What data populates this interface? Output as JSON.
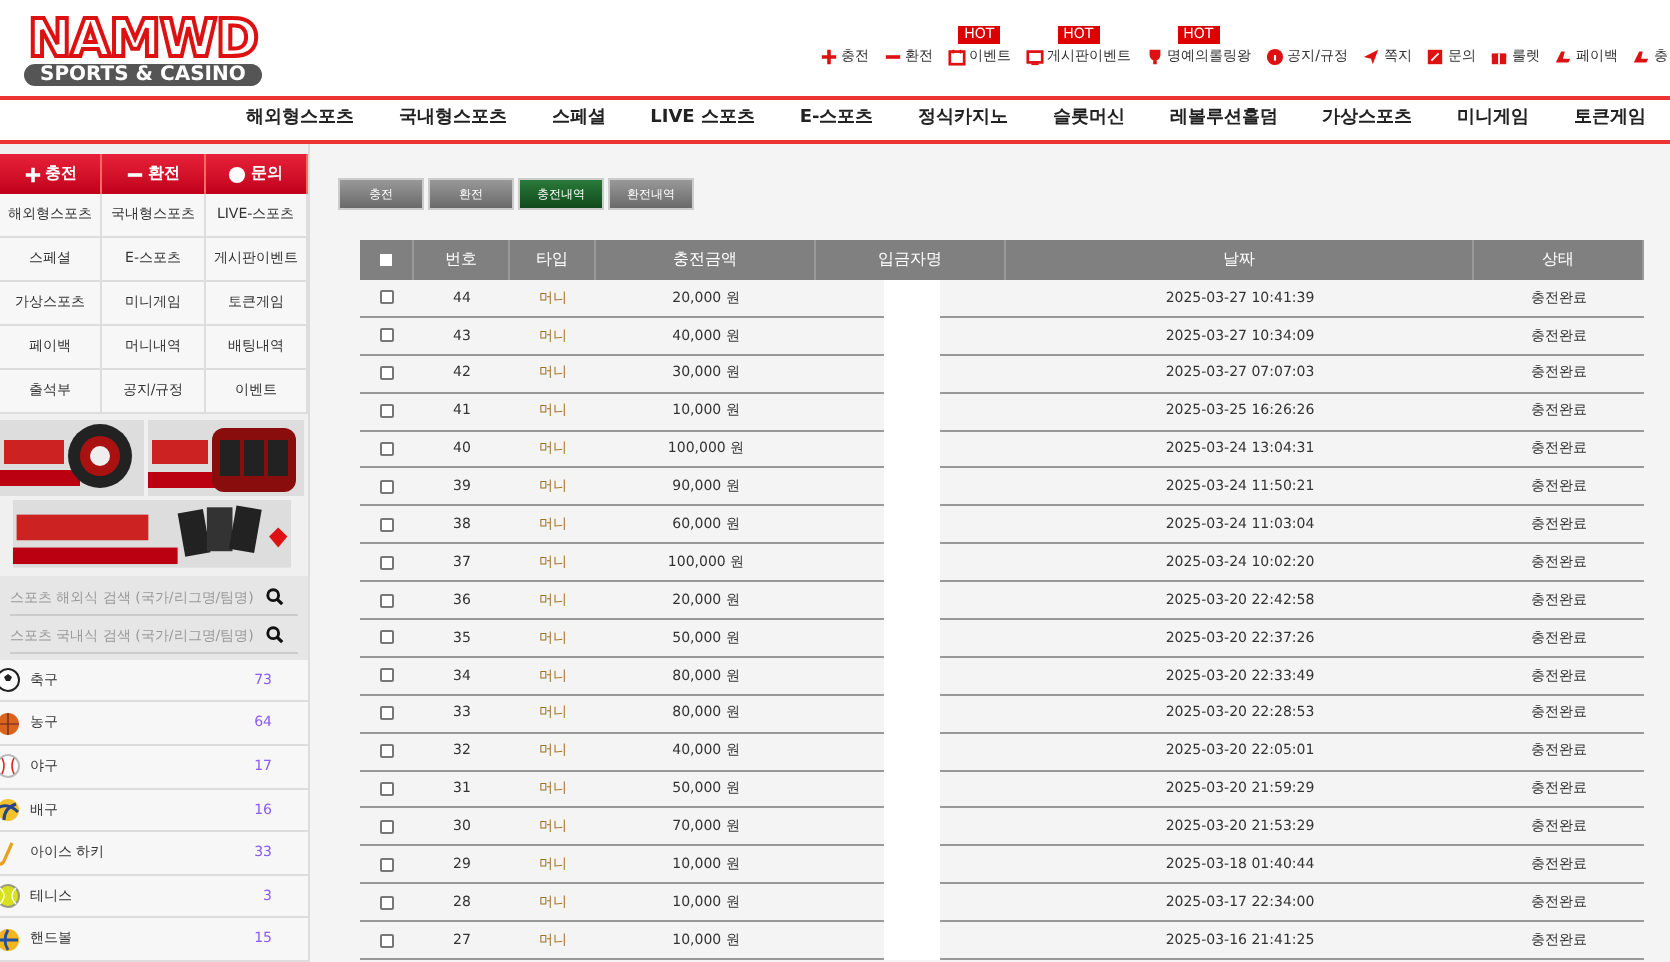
{
  "logo": {
    "name": "NAMWD",
    "tagline": "SPORTS & CASINO"
  },
  "top_links": [
    {
      "label": "충전",
      "hot": false
    },
    {
      "label": "환전",
      "hot": false
    },
    {
      "label": "이벤트",
      "hot": true,
      "badge": "HOT"
    },
    {
      "label": "게시판이벤트",
      "hot": true,
      "badge": "HOT"
    },
    {
      "label": "명예의롤링왕",
      "hot": true,
      "badge": "HOT"
    },
    {
      "label": "공지/규정",
      "hot": false
    },
    {
      "label": "쪽지",
      "hot": false
    },
    {
      "label": "문의",
      "hot": false
    },
    {
      "label": "룰렛",
      "hot": false
    },
    {
      "label": "페이백",
      "hot": false
    },
    {
      "label": "충",
      "hot": false
    }
  ],
  "nav": [
    "해외형스포츠",
    "국내형스포츠",
    "스페셜",
    "LIVE 스포츠",
    "E-스포츠",
    "정식카지노",
    "슬롯머신",
    "레볼루션홀덤",
    "가상스포츠",
    "미니게임",
    "토큰게임"
  ],
  "sidebar": {
    "actions": [
      {
        "label": "충전"
      },
      {
        "label": "환전"
      },
      {
        "label": "문의"
      }
    ],
    "links": [
      "해외형스포츠",
      "국내형스포츠",
      "LIVE-스포츠",
      "스페셜",
      "E-스포츠",
      "게시판이벤트",
      "가상스포츠",
      "미니게임",
      "토큰게임",
      "페이백",
      "머니내역",
      "배팅내역",
      "출석부",
      "공지/규정",
      "이벤트"
    ],
    "search": [
      {
        "placeholder": "스포츠 해외식 검색 (국가/리그명/팀명)"
      },
      {
        "placeholder": "스포츠 국내식 검색 (국가/리그명/팀명)"
      }
    ],
    "sports": [
      {
        "name": "축구",
        "count": "73"
      },
      {
        "name": "농구",
        "count": "64"
      },
      {
        "name": "야구",
        "count": "17"
      },
      {
        "name": "배구",
        "count": "16"
      },
      {
        "name": "아이스 하키",
        "count": "33"
      },
      {
        "name": "테니스",
        "count": "3"
      },
      {
        "name": "핸드볼",
        "count": "15"
      }
    ]
  },
  "tabs": [
    {
      "label": "충전",
      "selected": false
    },
    {
      "label": "환전",
      "selected": false
    },
    {
      "label": "충전내역",
      "selected": true
    },
    {
      "label": "환전내역",
      "selected": false
    }
  ],
  "table": {
    "select_all_checked": false,
    "columns": [
      "번호",
      "타입",
      "충전금액",
      "입금자명",
      "날짜",
      "상태"
    ],
    "rows": [
      {
        "checked": false,
        "no": "44",
        "type": "머니",
        "amount": "20,000 원",
        "date": "2025-03-27 10:41:39",
        "status": "충전완료"
      },
      {
        "checked": false,
        "no": "43",
        "type": "머니",
        "amount": "40,000 원",
        "date": "2025-03-27 10:34:09",
        "status": "충전완료"
      },
      {
        "checked": false,
        "no": "42",
        "type": "머니",
        "amount": "30,000 원",
        "date": "2025-03-27 07:07:03",
        "status": "충전완료"
      },
      {
        "checked": false,
        "no": "41",
        "type": "머니",
        "amount": "10,000 원",
        "date": "2025-03-25 16:26:26",
        "status": "충전완료"
      },
      {
        "checked": false,
        "no": "40",
        "type": "머니",
        "amount": "100,000 원",
        "date": "2025-03-24 13:04:31",
        "status": "충전완료"
      },
      {
        "checked": false,
        "no": "39",
        "type": "머니",
        "amount": "90,000 원",
        "date": "2025-03-24 11:50:21",
        "status": "충전완료"
      },
      {
        "checked": false,
        "no": "38",
        "type": "머니",
        "amount": "60,000 원",
        "date": "2025-03-24 11:03:04",
        "status": "충전완료"
      },
      {
        "checked": false,
        "no": "37",
        "type": "머니",
        "amount": "100,000 원",
        "date": "2025-03-24 10:02:20",
        "status": "충전완료"
      },
      {
        "checked": false,
        "no": "36",
        "type": "머니",
        "amount": "20,000 원",
        "date": "2025-03-20 22:42:58",
        "status": "충전완료"
      },
      {
        "checked": false,
        "no": "35",
        "type": "머니",
        "amount": "50,000 원",
        "date": "2025-03-20 22:37:26",
        "status": "충전완료"
      },
      {
        "checked": false,
        "no": "34",
        "type": "머니",
        "amount": "80,000 원",
        "date": "2025-03-20 22:33:49",
        "status": "충전완료"
      },
      {
        "checked": false,
        "no": "33",
        "type": "머니",
        "amount": "80,000 원",
        "date": "2025-03-20 22:28:53",
        "status": "충전완료"
      },
      {
        "checked": false,
        "no": "32",
        "type": "머니",
        "amount": "40,000 원",
        "date": "2025-03-20 22:05:01",
        "status": "충전완료"
      },
      {
        "checked": false,
        "no": "31",
        "type": "머니",
        "amount": "50,000 원",
        "date": "2025-03-20 21:59:29",
        "status": "충전완료"
      },
      {
        "checked": false,
        "no": "30",
        "type": "머니",
        "amount": "70,000 원",
        "date": "2025-03-20 21:53:29",
        "status": "충전완료"
      },
      {
        "checked": false,
        "no": "29",
        "type": "머니",
        "amount": "10,000 원",
        "date": "2025-03-18 01:40:44",
        "status": "충전완료"
      },
      {
        "checked": false,
        "no": "28",
        "type": "머니",
        "amount": "10,000 원",
        "date": "2025-03-17 22:34:00",
        "status": "충전완료"
      },
      {
        "checked": false,
        "no": "27",
        "type": "머니",
        "amount": "10,000 원",
        "date": "2025-03-16 21:41:25",
        "status": "충전완료"
      }
    ]
  }
}
